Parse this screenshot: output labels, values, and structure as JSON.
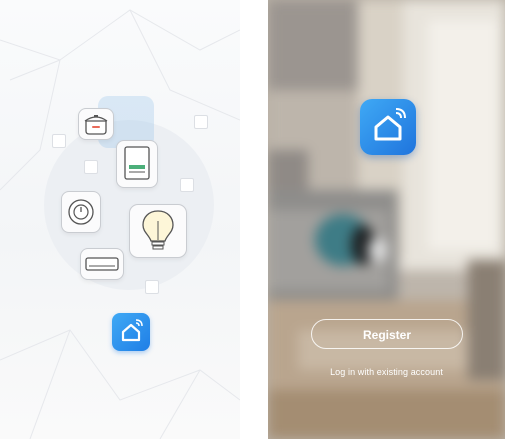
{
  "splash": {
    "app_icon": "smart-home-house-wifi-icon",
    "device_icons": [
      "rice-cooker-icon",
      "smart-switch-icon",
      "power-plug-icon",
      "light-bulb-icon",
      "air-conditioner-icon"
    ]
  },
  "login": {
    "app_icon": "smart-home-house-wifi-icon",
    "register_label": "Register",
    "login_link": "Log in with existing account"
  },
  "colors": {
    "brand_blue": "#2a8ef0",
    "button_border": "#ffffff"
  }
}
